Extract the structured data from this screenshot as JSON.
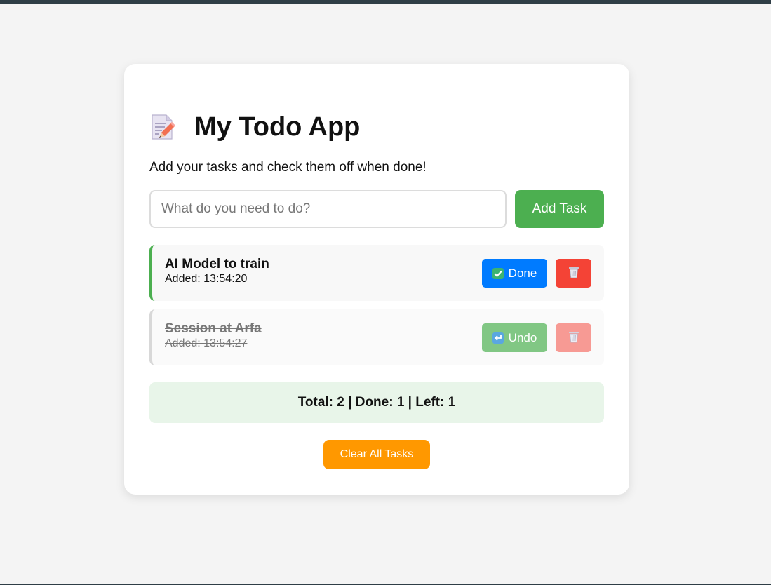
{
  "app": {
    "title": "My Todo App",
    "subtitle": "Add your tasks and check them off when done!"
  },
  "input": {
    "placeholder": "What do you need to do?",
    "value": "",
    "add_label": "Add Task"
  },
  "todos": [
    {
      "title": "AI Model to train",
      "time_label": "Added: 13:54:20",
      "done": false,
      "toggle_label": "Done",
      "toggle_icon": "check-box-icon",
      "delete_icon": "trash-bin-icon"
    },
    {
      "title": "Session at Arfa",
      "time_label": "Added: 13:54:27",
      "done": true,
      "toggle_label": "Undo",
      "toggle_icon": "undo-arrow-icon",
      "delete_icon": "trash-bin-icon"
    }
  ],
  "stats": {
    "text": "Total: 2 | Done: 1 | Left: 1"
  },
  "actions": {
    "clear_label": "Clear All Tasks"
  },
  "colors": {
    "add": "#4caf50",
    "done_button": "#007bff",
    "undo_button": "#81c784",
    "delete": "#f44336",
    "clear": "#ff9800",
    "stats_bg": "#e8f5e9"
  }
}
